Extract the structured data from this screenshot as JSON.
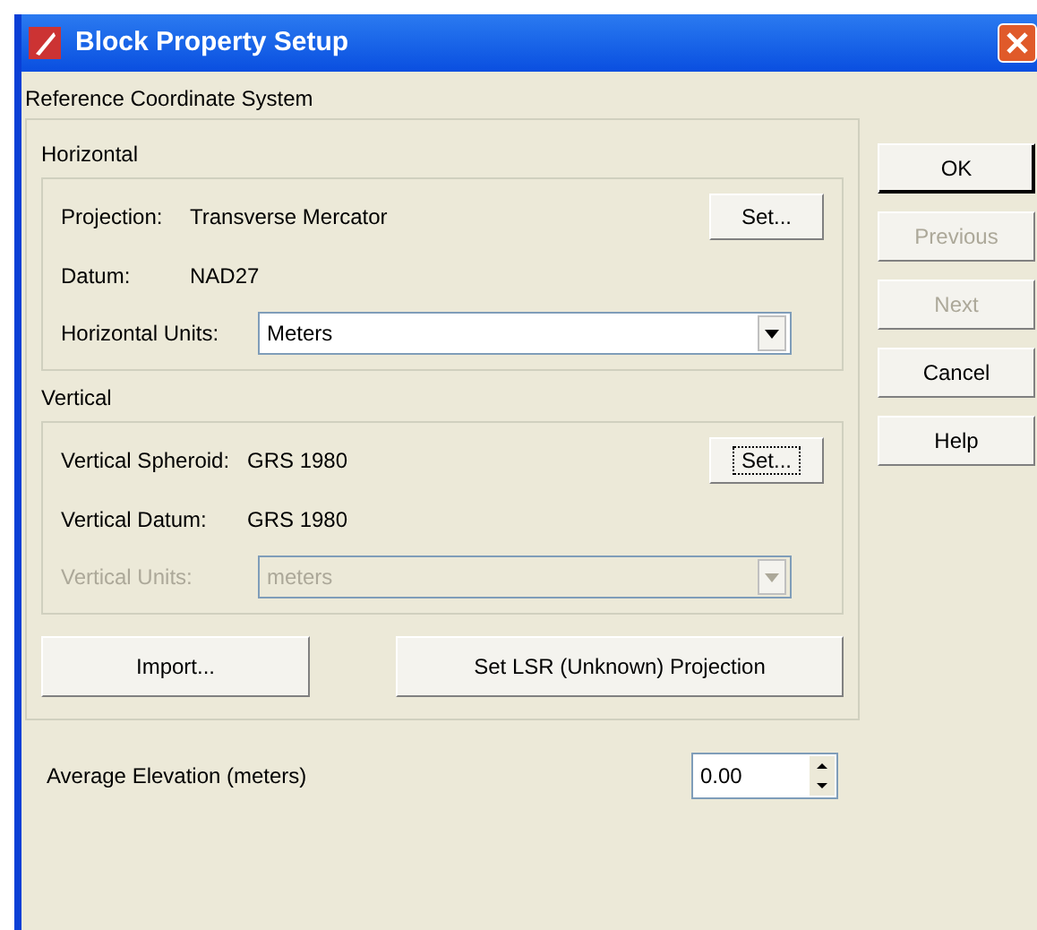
{
  "window": {
    "title": "Block Property Setup"
  },
  "reference_system": {
    "label": "Reference Coordinate System",
    "horizontal": {
      "label": "Horizontal",
      "projection": {
        "label": "Projection:",
        "value": "Transverse Mercator",
        "button": {
          "label": "Set...",
          "focused": false
        }
      },
      "datum": {
        "label": "Datum:",
        "value": "NAD27"
      },
      "units": {
        "label": "Horizontal Units:",
        "value": "Meters",
        "disabled": false
      }
    },
    "vertical": {
      "label": "Vertical",
      "spheroid": {
        "label": "Vertical Spheroid:",
        "value": "GRS 1980",
        "button": {
          "label": "Set...",
          "focused": true
        }
      },
      "datum": {
        "label": "Vertical Datum:",
        "value": "GRS 1980"
      },
      "units": {
        "label": "Vertical Units:",
        "value": "meters",
        "disabled": true
      }
    },
    "import_button": "Import...",
    "lsr_button": "Set LSR (Unknown) Projection"
  },
  "elevation": {
    "label": "Average Elevation (meters)",
    "value": "0.00"
  },
  "buttons": [
    {
      "label": "OK",
      "disabled": false,
      "default": true
    },
    {
      "label": "Previous",
      "disabled": true,
      "default": false
    },
    {
      "label": "Next",
      "disabled": true,
      "default": false
    },
    {
      "label": "Cancel",
      "disabled": false,
      "default": false
    },
    {
      "label": "Help",
      "disabled": false,
      "default": false
    }
  ]
}
